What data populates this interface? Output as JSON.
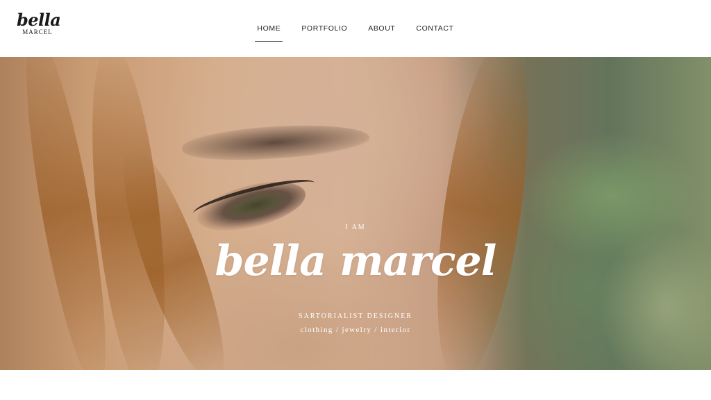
{
  "brand": {
    "logo_script": "bella",
    "logo_caps": "MARCEL"
  },
  "nav": {
    "items": [
      {
        "label": "HOME",
        "active": true
      },
      {
        "label": "PORTFOLIO",
        "active": false
      },
      {
        "label": "ABOUT",
        "active": false
      },
      {
        "label": "CONTACT",
        "active": false
      }
    ]
  },
  "hero": {
    "eyebrow": "I AM",
    "title": "bella marcel",
    "subtitle": "SARTORIALIST DESIGNER",
    "tagline": "clothing / jewelry / interior"
  }
}
